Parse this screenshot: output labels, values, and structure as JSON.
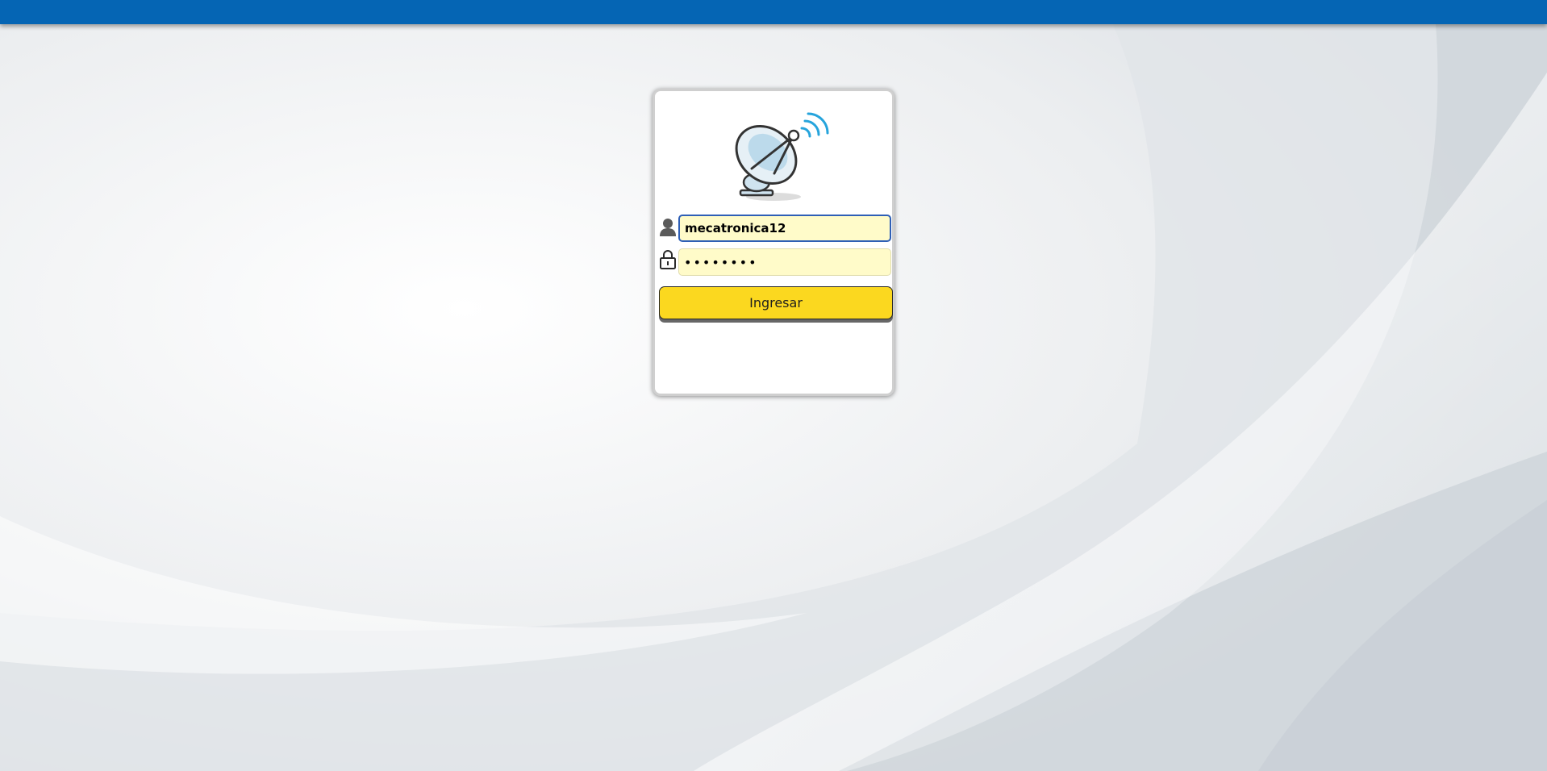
{
  "login": {
    "username_value": "mecatronica12",
    "password_value": "mecatron",
    "submit_label": "Ingresar"
  },
  "icons": {
    "logo": "satellite-dish-icon",
    "user": "user-icon",
    "password": "lock-icon"
  },
  "colors": {
    "header": "#0565b4",
    "button": "#fbd81f",
    "field_background": "#fffbc9",
    "field_focus_border": "#2e5fb6",
    "signal_waves": "#26a4dc"
  }
}
